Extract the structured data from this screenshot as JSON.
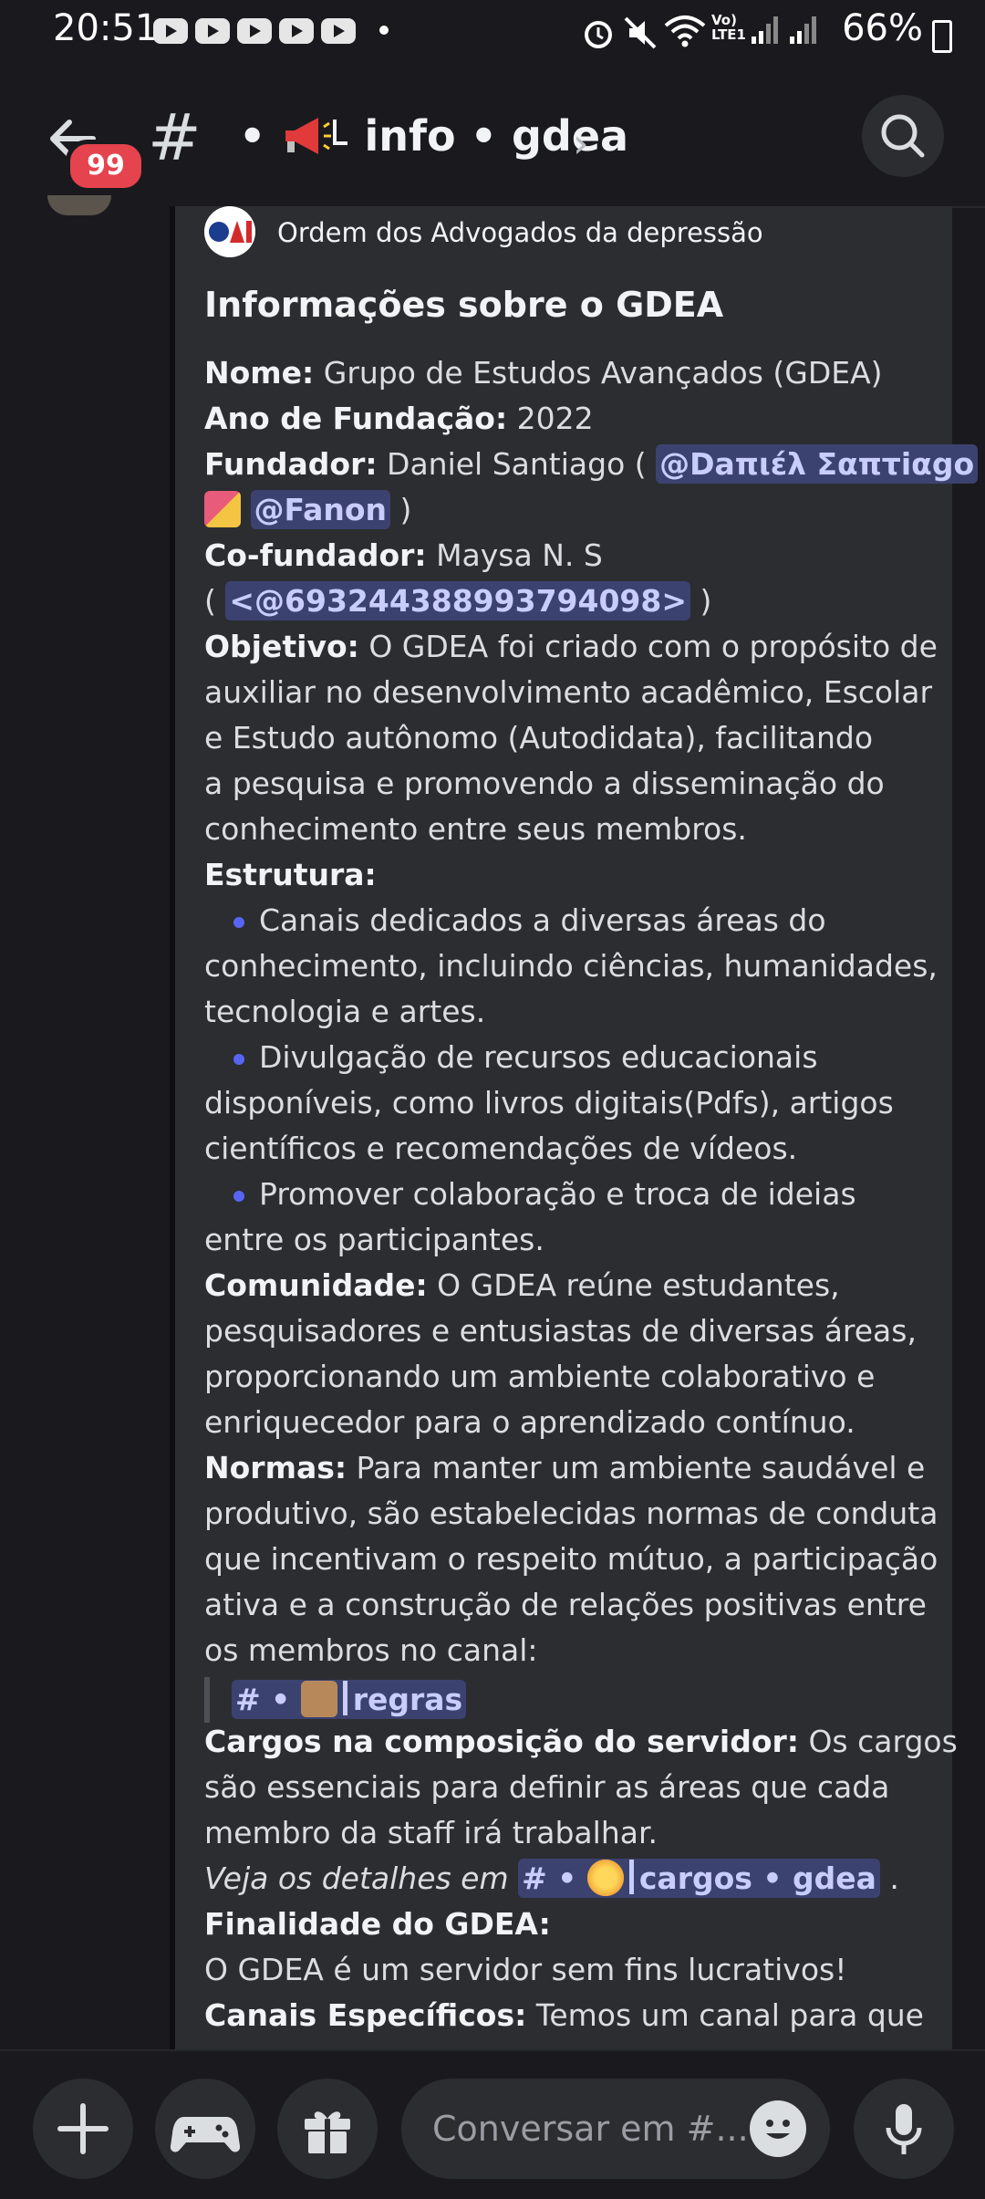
{
  "status_bar": {
    "time": "20:51",
    "battery": "66%",
    "network_label": "Vo) LTE1"
  },
  "header": {
    "unread_count": "99",
    "channel_prefix": "•",
    "channel_name": "info • gdea"
  },
  "embed": {
    "author": "Ordem dos Advogados da depressão",
    "title": "Informações sobre o GDEA",
    "lines": {
      "l1_label": "Nome:",
      "l1_text": " Grupo de Estudos Avançados (GDEA)",
      "l2_label": "Ano de Fundação:",
      "l2_text": " 2022",
      "l3_label": "Fundador:",
      "l3_text": " Daniel Santiago  ( ",
      "l3_mention": "@Daπιέλ Σαπτiαgo",
      "l4_mention": "@Fanon",
      "l4_text": " )",
      "l5_label": "Co-fundador:",
      "l5_text": " Maysa N. S",
      "l6_open": "( ",
      "l6_mention": "<@693244388993794098>",
      "l6_close": " )",
      "obj_label": "Objetivo:",
      "obj1": " O GDEA foi criado com o propósito de",
      "obj2": "auxiliar no desenvolvimento acadêmico, Escolar",
      "obj3": "e Estudo autônomo (Autodidata), facilitando",
      "obj4": "a pesquisa e promovendo a disseminação do",
      "obj5": "conhecimento entre seus membros.",
      "estr_label": "Estrutura:",
      "b1a": "Canais dedicados a diversas áreas do",
      "b1b": "conhecimento, incluindo ciências, humanidades,",
      "b1c": "tecnologia e artes.",
      "b2a": "Divulgação de recursos educacionais",
      "b2b": "disponíveis, como livros digitais(Pdfs), artigos",
      "b2c": "científicos e recomendações de vídeos.",
      "b3a": "Promover colaboração e troca de ideias",
      "b3b": "entre os participantes.",
      "com_label": "Comunidade:",
      "com1": " O GDEA reúne estudantes,",
      "com2": "pesquisadores e entusiastas de diversas áreas,",
      "com3": "proporcionando um ambiente colaborativo e",
      "com4": "enriquecedor para o aprendizado contínuo.",
      "norm_label": "Normas:",
      "norm1": " Para manter um ambiente saudável e",
      "norm2": "produtivo, são estabelecidas normas de conduta",
      "norm3": "que incentivam o respeito mútuo, a participação",
      "norm4": "ativa e a construção de relações positivas entre",
      "norm5": "os membros no canal:",
      "regras_hash": "# •",
      "regras_name": "regras",
      "cargos_label": "Cargos na composição do servidor:",
      "cargos1": " Os cargos",
      "cargos2": "são essenciais para definir as áreas que cada",
      "cargos3": "membro da staff irá trabalhar.",
      "veja": "Veja os detalhes em ",
      "cargos_hash": "# •",
      "cargos_name": "cargos • gdea",
      "veja_end": " .",
      "fin_label": "Finalidade do GDEA:",
      "fin1": "O GDEA é um servidor sem fins lucrativos!",
      "can_label": "Canais Específicos:",
      "can1": " Temos um canal para que"
    }
  },
  "composer": {
    "placeholder": "Conversar em #..."
  },
  "colors": {
    "background": "#1a1a1e",
    "embed": "#2b2d31",
    "mention_bg": "#3c4270",
    "badge": "#e5434d"
  }
}
